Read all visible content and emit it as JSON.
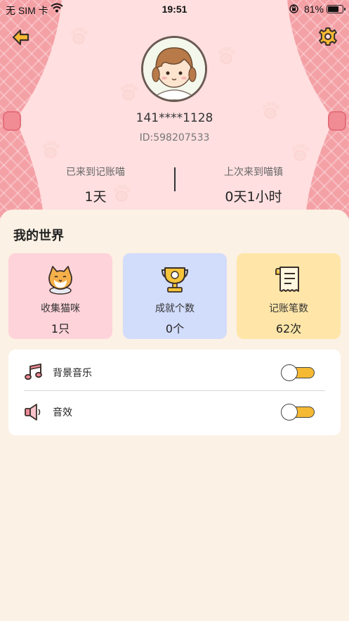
{
  "status_bar": {
    "carrier": "无 SIM 卡",
    "time": "19:51",
    "battery_pct": "81%",
    "battery_level": 0.81
  },
  "header": {
    "back_icon": "arrow-left-icon",
    "settings_icon": "gear-icon"
  },
  "profile": {
    "phone": "141****1128",
    "user_id": "ID:598207533"
  },
  "stats": {
    "days_label": "已来到记账喵",
    "days_value": "1天",
    "last_label": "上次来到喵镇",
    "last_value": "0天1小时"
  },
  "world": {
    "title": "我的世界",
    "cards": [
      {
        "label": "收集猫咪",
        "value": "1只",
        "icon": "cat-icon"
      },
      {
        "label": "成就个数",
        "value": "0个",
        "icon": "trophy-icon"
      },
      {
        "label": "记账笔数",
        "value": "62次",
        "icon": "receipt-icon"
      }
    ]
  },
  "settings": {
    "music_label": "背景音乐",
    "sound_label": "音效"
  },
  "colors": {
    "accent": "#f5b933",
    "stage_bg": "#ffdfe0",
    "sheet_bg": "#fbf1e4"
  }
}
